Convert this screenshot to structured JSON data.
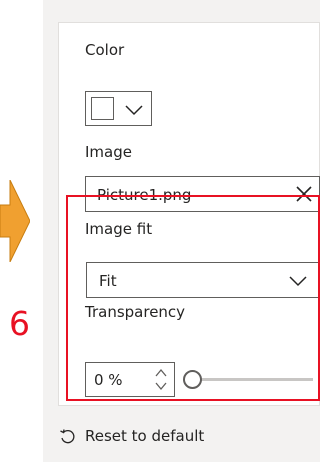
{
  "annotation": {
    "step_number": "6"
  },
  "format_pane": {
    "color": {
      "label": "Color",
      "value_color": "#ffffff"
    },
    "image": {
      "label": "Image",
      "file_name": "Picture1.png"
    },
    "image_fit": {
      "label": "Image fit",
      "selected": "Fit"
    },
    "transparency": {
      "label": "Transparency",
      "value": "0 %",
      "slider_fraction": 0
    },
    "reset_label": "Reset to default"
  },
  "colors": {
    "highlight": "#e81123",
    "arrow": "#f0a030",
    "panel_bg": "#f3f2f1"
  }
}
